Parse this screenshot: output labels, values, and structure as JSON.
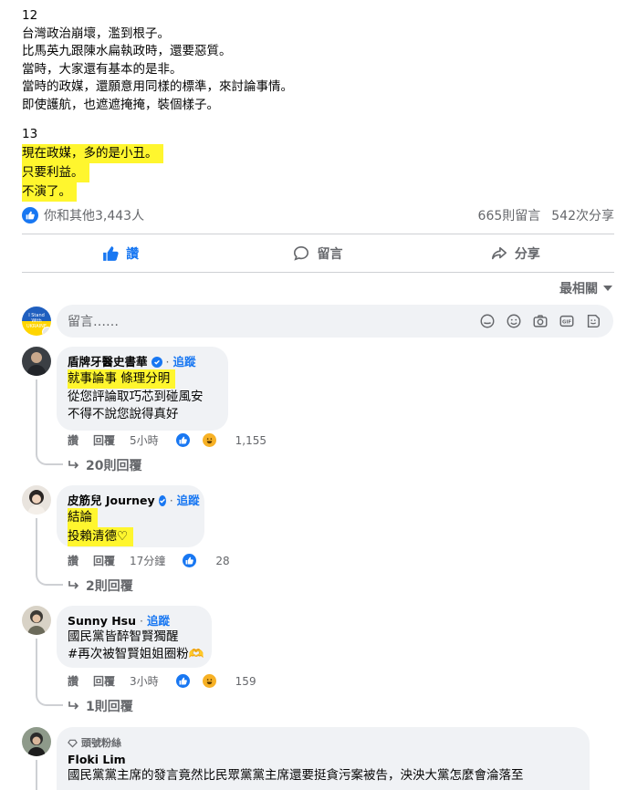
{
  "post": {
    "paragraphs": [
      {
        "lines": [
          "12",
          "台灣政治崩壞，濫到根子。",
          "比馬英九跟陳水扁執政時，還要惡質。",
          "當時，大家還有基本的是非。",
          "當時的政媒，還願意用同樣的標準，來討論事情。",
          "即使護航，也遮遮掩掩，裝個樣子。"
        ]
      },
      {
        "lines": [
          "13"
        ],
        "highlighted": [
          "現在政媒，多的是小丑。",
          "只要利益。",
          "不演了。"
        ]
      }
    ],
    "reactions_text": "你和其他3,443人",
    "comments_count": "665則留言",
    "shares_count": "542次分享"
  },
  "actions": {
    "like": "讚",
    "comment": "留言",
    "share": "分享"
  },
  "sort_label": "最相關",
  "composer": {
    "placeholder": "留言……",
    "avatar_text": "I Stand With UKRAINE"
  },
  "comments": [
    {
      "author": "盾牌牙醫史書華",
      "verified": true,
      "follow": "追蹤",
      "highlighted": [
        "就事論事 條理分明"
      ],
      "lines": [
        "從您評論取巧芯到碰風安",
        "不得不說您說得真好"
      ],
      "like": "讚",
      "reply": "回覆",
      "time": "5小時",
      "react_count": "1,155",
      "replies": "20則回覆"
    },
    {
      "author": "皮筋兒 Journey",
      "verified": true,
      "follow": "追蹤",
      "highlighted": [
        "結論",
        "投賴清德♡"
      ],
      "lines": [],
      "like": "讚",
      "reply": "回覆",
      "time": "17分鐘",
      "react_count": "28",
      "replies": "2則回覆"
    },
    {
      "author": "Sunny Hsu",
      "verified": false,
      "follow": "追蹤",
      "highlighted": [],
      "lines": [
        "國民黨皆醉智賢獨醒",
        "#再次被智賢姐姐圈粉🫶"
      ],
      "like": "讚",
      "reply": "回覆",
      "time": "3小時",
      "react_count": "159",
      "replies": "1則回覆"
    },
    {
      "badge": "頭號粉絲",
      "author": "Floki Lim",
      "lines": [
        "國民黨黨主席的發言竟然比民眾黨黨主席還要挺貪污案被告，泱泱大黨怎麼會淪落至"
      ]
    }
  ],
  "colors": {
    "accent": "#1877f2",
    "highlight": "#fff62e",
    "bubble": "#f0f2f5",
    "muted": "#65676b"
  }
}
